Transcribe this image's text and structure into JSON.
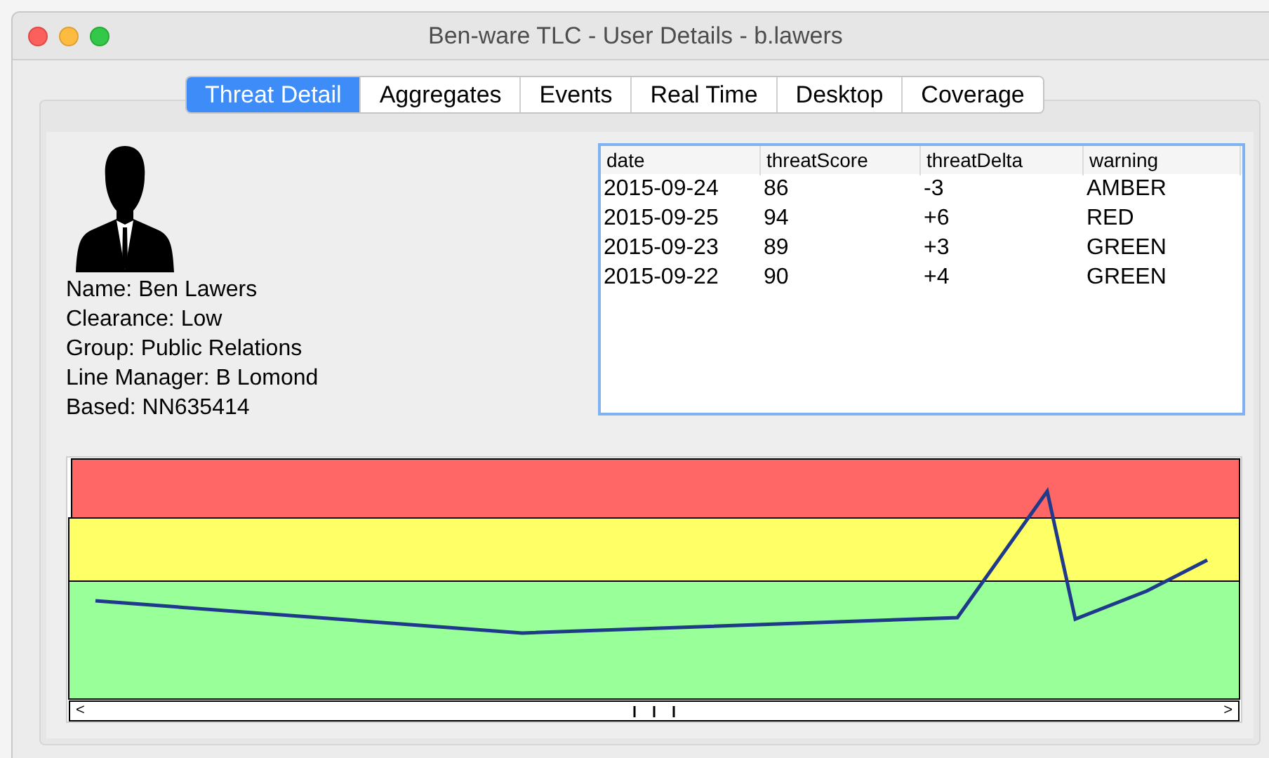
{
  "window": {
    "title": "Ben-ware TLC - User Details - b.lawers"
  },
  "tabs": [
    {
      "label": "Threat Detail",
      "selected": true
    },
    {
      "label": "Aggregates",
      "selected": false
    },
    {
      "label": "Events",
      "selected": false
    },
    {
      "label": "Real Time",
      "selected": false
    },
    {
      "label": "Desktop",
      "selected": false
    },
    {
      "label": "Coverage",
      "selected": false
    }
  ],
  "user_details": [
    "Name: Ben Lawers",
    "Clearance: Low",
    "Group: Public Relations",
    "Line Manager: B Lomond",
    "Based: NN635414"
  ],
  "table": {
    "columns": [
      "date",
      "threatScore",
      "threatDelta",
      "warning"
    ],
    "rows": [
      [
        "2015-09-24",
        "86",
        "-3",
        "AMBER"
      ],
      [
        "2015-09-25",
        "94",
        "+6",
        "RED"
      ],
      [
        "2015-09-23",
        "89",
        "+3",
        "GREEN"
      ],
      [
        "2015-09-22",
        "90",
        "+4",
        "GREEN"
      ]
    ]
  },
  "chart_scrollbar": {
    "left_arrow": "<",
    "right_arrow": ">"
  }
}
